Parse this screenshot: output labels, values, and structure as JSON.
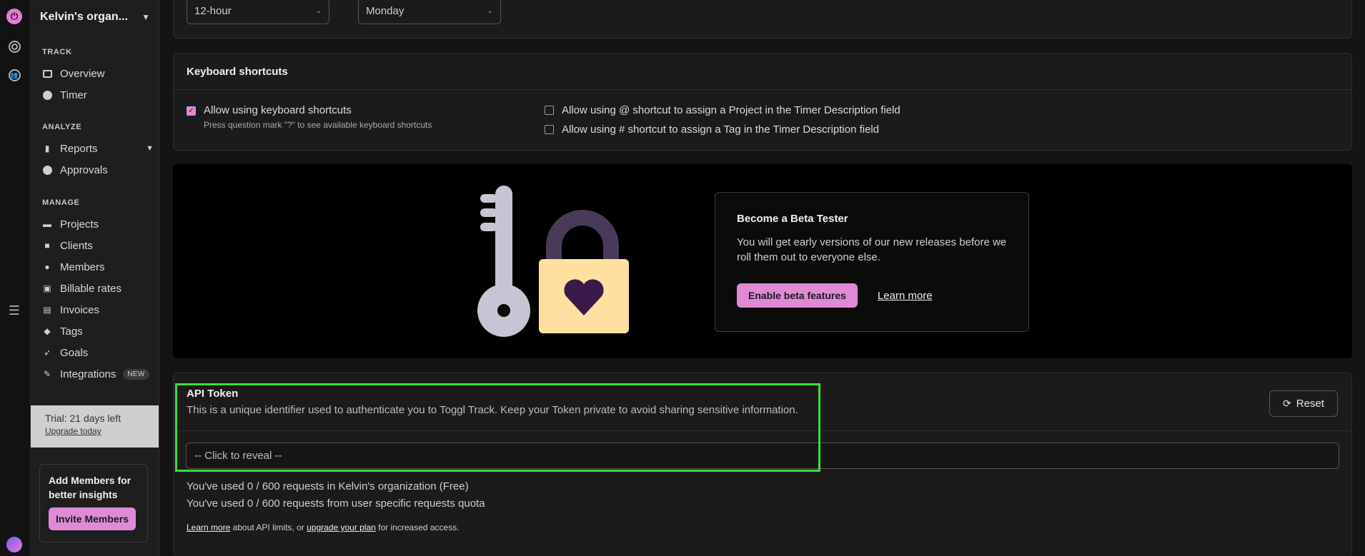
{
  "sidebar": {
    "org_name": "Kelvin's organ...",
    "sections": {
      "track": "TRACK",
      "analyze": "ANALYZE",
      "manage": "MANAGE"
    },
    "items": {
      "overview": "Overview",
      "timer": "Timer",
      "reports": "Reports",
      "approvals": "Approvals",
      "projects": "Projects",
      "clients": "Clients",
      "members": "Members",
      "billable_rates": "Billable rates",
      "invoices": "Invoices",
      "tags": "Tags",
      "goals": "Goals",
      "integrations": "Integrations"
    },
    "integrations_badge": "NEW",
    "trial": {
      "text": "Trial: 21 days left",
      "link": "Upgrade today"
    },
    "promo": {
      "title": "Add Members for better insights",
      "button": "Invite Members"
    }
  },
  "time_format": {
    "value": "12-hour"
  },
  "week_start": {
    "value": "Monday"
  },
  "shortcuts": {
    "title": "Keyboard shortcuts",
    "allow_keyboard": "Allow using keyboard shortcuts",
    "allow_keyboard_sub": "Press question mark \"?\" to see available keyboard shortcuts",
    "allow_project": "Allow using @ shortcut to assign a Project in the Timer Description field",
    "allow_tag": "Allow using # shortcut to assign a Tag in the Timer Description field",
    "allow_keyboard_checked": true,
    "allow_project_checked": false,
    "allow_tag_checked": false
  },
  "beta": {
    "title": "Become a Beta Tester",
    "description": "You will get early versions of our new releases before we roll them out to everyone else.",
    "enable_button": "Enable beta features",
    "learn_more": "Learn more"
  },
  "api": {
    "title": "API Token",
    "description": "This is a unique identifier used to authenticate you to Toggl Track. Keep your Token private to avoid sharing sensitive information.",
    "reset": "Reset",
    "token_placeholder": "-- Click to reveal --",
    "usage_org": "You've used 0 / 600 requests in Kelvin's organization (Free)",
    "usage_user": "You've used 0 / 600 requests from user specific requests quota",
    "footnote_link1": "Learn more",
    "footnote_mid": " about API limits, or ",
    "footnote_link2": "upgrade your plan",
    "footnote_end": " for increased access."
  },
  "colors": {
    "accent": "#e08ad6",
    "highlight": "#3ddc3d",
    "lock_body": "#ffe0a0",
    "heart": "#3a1a4a",
    "key": "#c8c4d4"
  }
}
